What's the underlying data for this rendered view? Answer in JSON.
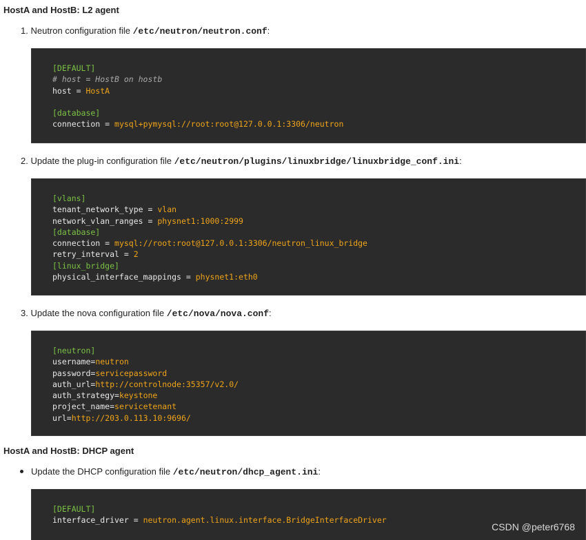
{
  "section1": {
    "heading": "HostA and HostB: L2 agent",
    "step1": {
      "num": "1.",
      "text": "Neutron configuration file ",
      "path": "/etc/neutron/neutron.conf",
      "suffix": ":"
    },
    "code1": {
      "l1_sec": "[DEFAULT]",
      "l2_cmt": "# host = HostB on hostb",
      "l3_key": "host",
      "l3_op": " = ",
      "l3_val": "HostA",
      "l5_sec": "[database]",
      "l6_key": "connection",
      "l6_op": " = ",
      "l6_val": "mysql+pymysql://root:root@127.0.0.1:3306/neutron"
    },
    "step2": {
      "num": "2.",
      "text": "Update the plug-in configuration file ",
      "path": "/etc/neutron/plugins/linuxbridge/linuxbridge_conf.ini",
      "suffix": ":"
    },
    "code2": {
      "l1_sec": "[vlans]",
      "l2_key": "tenant_network_type",
      "l2_op": " = ",
      "l2_val": "vlan",
      "l3_key": "network_vlan_ranges",
      "l3_op": " = ",
      "l3_val": "physnet1:1000:2999",
      "l4_sec": "[database]",
      "l5_key": "connection",
      "l5_op": " = ",
      "l5_val": "mysql://root:root@127.0.0.1:3306/neutron_linux_bridge",
      "l6_key": "retry_interval",
      "l6_op": " = ",
      "l6_val": "2",
      "l7_sec": "[linux_bridge]",
      "l8_key": "physical_interface_mappings",
      "l8_op": " = ",
      "l8_val": "physnet1:eth0"
    },
    "step3": {
      "num": "3.",
      "text": "Update the nova configuration file ",
      "path": "/etc/nova/nova.conf",
      "suffix": ":"
    },
    "code3": {
      "l1_sec": "[neutron]",
      "l2_key": "username",
      "l2_op": "=",
      "l2_val": "neutron",
      "l3_key": "password",
      "l3_op": "=",
      "l3_val": "servicepassword",
      "l4_key": "auth_url",
      "l4_op": "=",
      "l4_val": "http://controlnode:35357/v2.0/",
      "l5_key": "auth_strategy",
      "l5_op": "=",
      "l5_val": "keystone",
      "l6_key": "project_name",
      "l6_op": "=",
      "l6_val": "servicetenant",
      "l7_key": "url",
      "l7_op": "=",
      "l7_val": "http://203.0.113.10:9696/"
    }
  },
  "section2": {
    "heading": "HostA and HostB: DHCP agent",
    "bullet1": {
      "text": "Update the DHCP configuration file ",
      "path": "/etc/neutron/dhcp_agent.ini",
      "suffix": ":"
    },
    "code4": {
      "l1_sec": "[DEFAULT]",
      "l2_key": "interface_driver",
      "l2_op": " = ",
      "l2_val": "neutron.agent.linux.interface.BridgeInterfaceDriver"
    }
  },
  "watermark": "CSDN @peter6768",
  "colors": {
    "code_bg": "#2b2b2b",
    "section": "#7cc245",
    "value": "#f0a419",
    "comment": "#a8a8a8"
  }
}
